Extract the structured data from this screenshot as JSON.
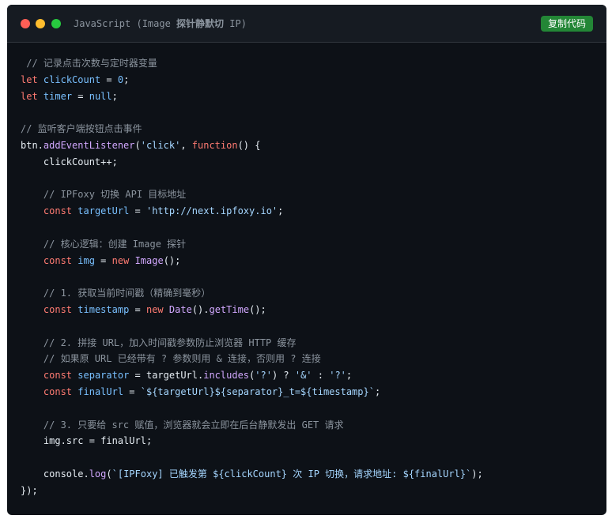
{
  "window": {
    "title_prefix": "JavaScript (Image ",
    "title_bold": "探针静默切",
    "title_suffix": " IP)",
    "copy_button_label": "复制代码"
  },
  "colors": {
    "red": "#ff5f56",
    "yellow": "#ffbd2e",
    "green": "#27c93f",
    "copy_button": "#238636",
    "comment": "#8b949e",
    "keyword": "#ff7b72",
    "variable": "#79c0ff",
    "function": "#d2a8ff",
    "string": "#a5d6ff",
    "default": "#e6edf3"
  },
  "code_lines": [
    [
      [
        " // 记录点击次数与定时器变量",
        "comment"
      ]
    ],
    [
      [
        "let",
        "keyword"
      ],
      [
        " ",
        "default"
      ],
      [
        "clickCount",
        "variable"
      ],
      [
        " = ",
        "default"
      ],
      [
        "0",
        "variable"
      ],
      [
        ";",
        "default"
      ]
    ],
    [
      [
        "let",
        "keyword"
      ],
      [
        " ",
        "default"
      ],
      [
        "timer",
        "variable"
      ],
      [
        " = ",
        "default"
      ],
      [
        "null",
        "variable"
      ],
      [
        ";",
        "default"
      ]
    ],
    [],
    [
      [
        "// 监听客户端按钮点击事件",
        "comment"
      ]
    ],
    [
      [
        "btn.",
        "default"
      ],
      [
        "addEventListener",
        "function"
      ],
      [
        "(",
        "default"
      ],
      [
        "'click'",
        "string"
      ],
      [
        ", ",
        "default"
      ],
      [
        "function",
        "keyword"
      ],
      [
        "() {",
        "default"
      ]
    ],
    [
      [
        "    clickCount++;",
        "default"
      ]
    ],
    [],
    [
      [
        "    // IPFoxy 切换 API 目标地址",
        "comment"
      ]
    ],
    [
      [
        "    ",
        "default"
      ],
      [
        "const",
        "keyword"
      ],
      [
        " ",
        "default"
      ],
      [
        "targetUrl",
        "variable"
      ],
      [
        " = ",
        "default"
      ],
      [
        "'http://next.ipfoxy.io'",
        "string"
      ],
      [
        ";",
        "default"
      ]
    ],
    [],
    [
      [
        "    // 核心逻辑：创建 Image 探针",
        "comment"
      ]
    ],
    [
      [
        "    ",
        "default"
      ],
      [
        "const",
        "keyword"
      ],
      [
        " ",
        "default"
      ],
      [
        "img",
        "variable"
      ],
      [
        " = ",
        "default"
      ],
      [
        "new",
        "keyword"
      ],
      [
        " ",
        "default"
      ],
      [
        "Image",
        "function"
      ],
      [
        "();",
        "default"
      ]
    ],
    [],
    [
      [
        "    // 1. 获取当前时间戳（精确到毫秒）",
        "comment"
      ]
    ],
    [
      [
        "    ",
        "default"
      ],
      [
        "const",
        "keyword"
      ],
      [
        " ",
        "default"
      ],
      [
        "timestamp",
        "variable"
      ],
      [
        " = ",
        "default"
      ],
      [
        "new",
        "keyword"
      ],
      [
        " ",
        "default"
      ],
      [
        "Date",
        "function"
      ],
      [
        "().",
        "default"
      ],
      [
        "getTime",
        "function"
      ],
      [
        "();",
        "default"
      ]
    ],
    [],
    [
      [
        "    // 2. 拼接 URL，加入时间戳参数防止浏览器 HTTP 缓存",
        "comment"
      ]
    ],
    [
      [
        "    // 如果原 URL 已经带有 ? 参数则用 & 连接，否则用 ? 连接",
        "comment"
      ]
    ],
    [
      [
        "    ",
        "default"
      ],
      [
        "const",
        "keyword"
      ],
      [
        " ",
        "default"
      ],
      [
        "separator",
        "variable"
      ],
      [
        " = targetUrl.",
        "default"
      ],
      [
        "includes",
        "function"
      ],
      [
        "(",
        "default"
      ],
      [
        "'?'",
        "string"
      ],
      [
        ") ? ",
        "default"
      ],
      [
        "'&'",
        "string"
      ],
      [
        " : ",
        "default"
      ],
      [
        "'?'",
        "string"
      ],
      [
        ";",
        "default"
      ]
    ],
    [
      [
        "    ",
        "default"
      ],
      [
        "const",
        "keyword"
      ],
      [
        " ",
        "default"
      ],
      [
        "finalUrl",
        "variable"
      ],
      [
        " = ",
        "default"
      ],
      [
        "`${targetUrl}${separator}_t=${timestamp}`",
        "string"
      ],
      [
        ";",
        "default"
      ]
    ],
    [],
    [
      [
        "    // 3. 只要给 src 赋值，浏览器就会立即在后台静默发出 GET 请求",
        "comment"
      ]
    ],
    [
      [
        "    img.src = finalUrl;",
        "default"
      ]
    ],
    [],
    [
      [
        "    console.",
        "default"
      ],
      [
        "log",
        "function"
      ],
      [
        "(",
        "default"
      ],
      [
        "`[IPFoxy] 已触发第 ${clickCount} 次 IP 切换，请求地址: ${finalUrl}`",
        "string"
      ],
      [
        ");",
        "default"
      ]
    ],
    [
      [
        "});",
        "default"
      ]
    ]
  ]
}
